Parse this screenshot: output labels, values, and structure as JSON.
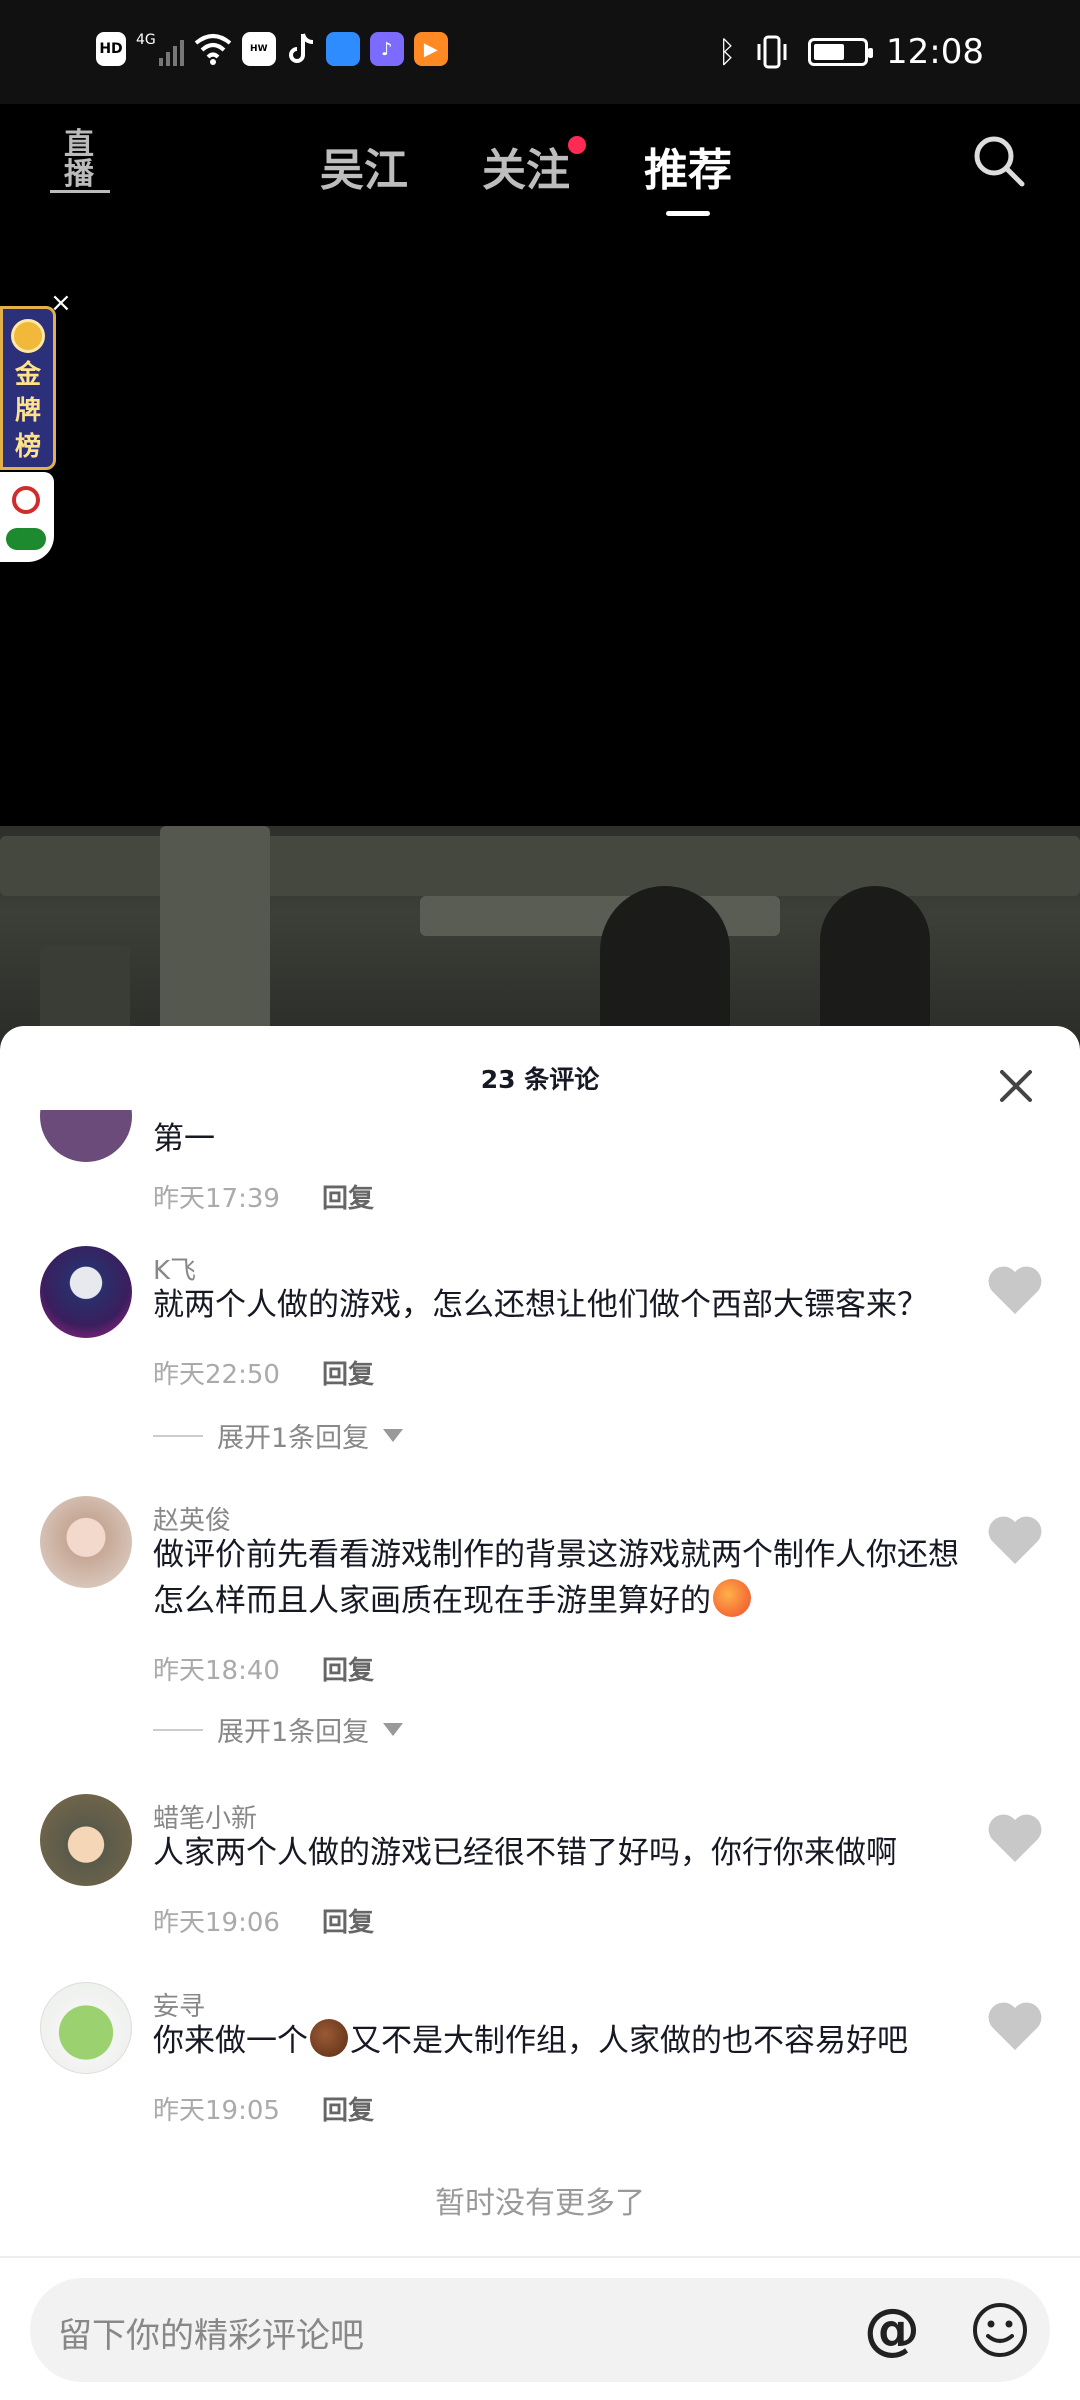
{
  "status_bar": {
    "icons": [
      "hd-badge",
      "4g-signal-icon",
      "wifi-icon",
      "huawei-app-icon",
      "tiktok-icon",
      "app-icon-blue",
      "music-app-icon",
      "video-app-icon"
    ],
    "labels": {
      "hd": "HD",
      "net": "4G"
    },
    "time": "12:08",
    "battery_level": 0.55
  },
  "top_nav": {
    "live_label": "直播",
    "tabs": [
      {
        "label": "吴江",
        "active": false
      },
      {
        "label": "关注",
        "active": false,
        "dot": true
      },
      {
        "label": "推荐",
        "active": true
      }
    ]
  },
  "medal_badge": {
    "close": "×",
    "title_chars": [
      "金",
      "牌",
      "榜"
    ]
  },
  "comments_sheet": {
    "title": "23 条评论",
    "comments": [
      {
        "user": "",
        "text": "第一",
        "time": "昨天17:39",
        "reply": "回复",
        "avatar_color": "#6b4b7a"
      },
      {
        "user": "K飞",
        "text": "就两个人做的游戏，怎么还想让他们做个西部大镖客来？",
        "time": "昨天22:50",
        "reply": "回复",
        "expand": "展开1条回复",
        "avatar_color": "#2a2f6b"
      },
      {
        "user": "赵英俊",
        "text": "做评价前先看看游戏制作的背景这游戏就两个制作人你还想怎么样而且人家画质在现在手游里算好的",
        "time": "昨天18:40",
        "reply": "回复",
        "expand": "展开1条回复",
        "avatar_color": "#d9c3b6"
      },
      {
        "user": "蜡笔小新",
        "text": "人家两个人做的游戏已经很不错了好吗，你行你来做啊",
        "time": "昨天19:06",
        "reply": "回复",
        "avatar_color": "#7a6a4a"
      },
      {
        "user": "妄寻",
        "text_a": "你来做一个",
        "text_b": "又不是大制作组，人家做的也不容易好吧",
        "time": "昨天19:05",
        "reply": "回复",
        "avatar_color": "#8cc36a"
      }
    ],
    "no_more": "暂时没有更多了"
  },
  "input_bar": {
    "placeholder": "留下你的精彩评论吧",
    "at": "@"
  }
}
